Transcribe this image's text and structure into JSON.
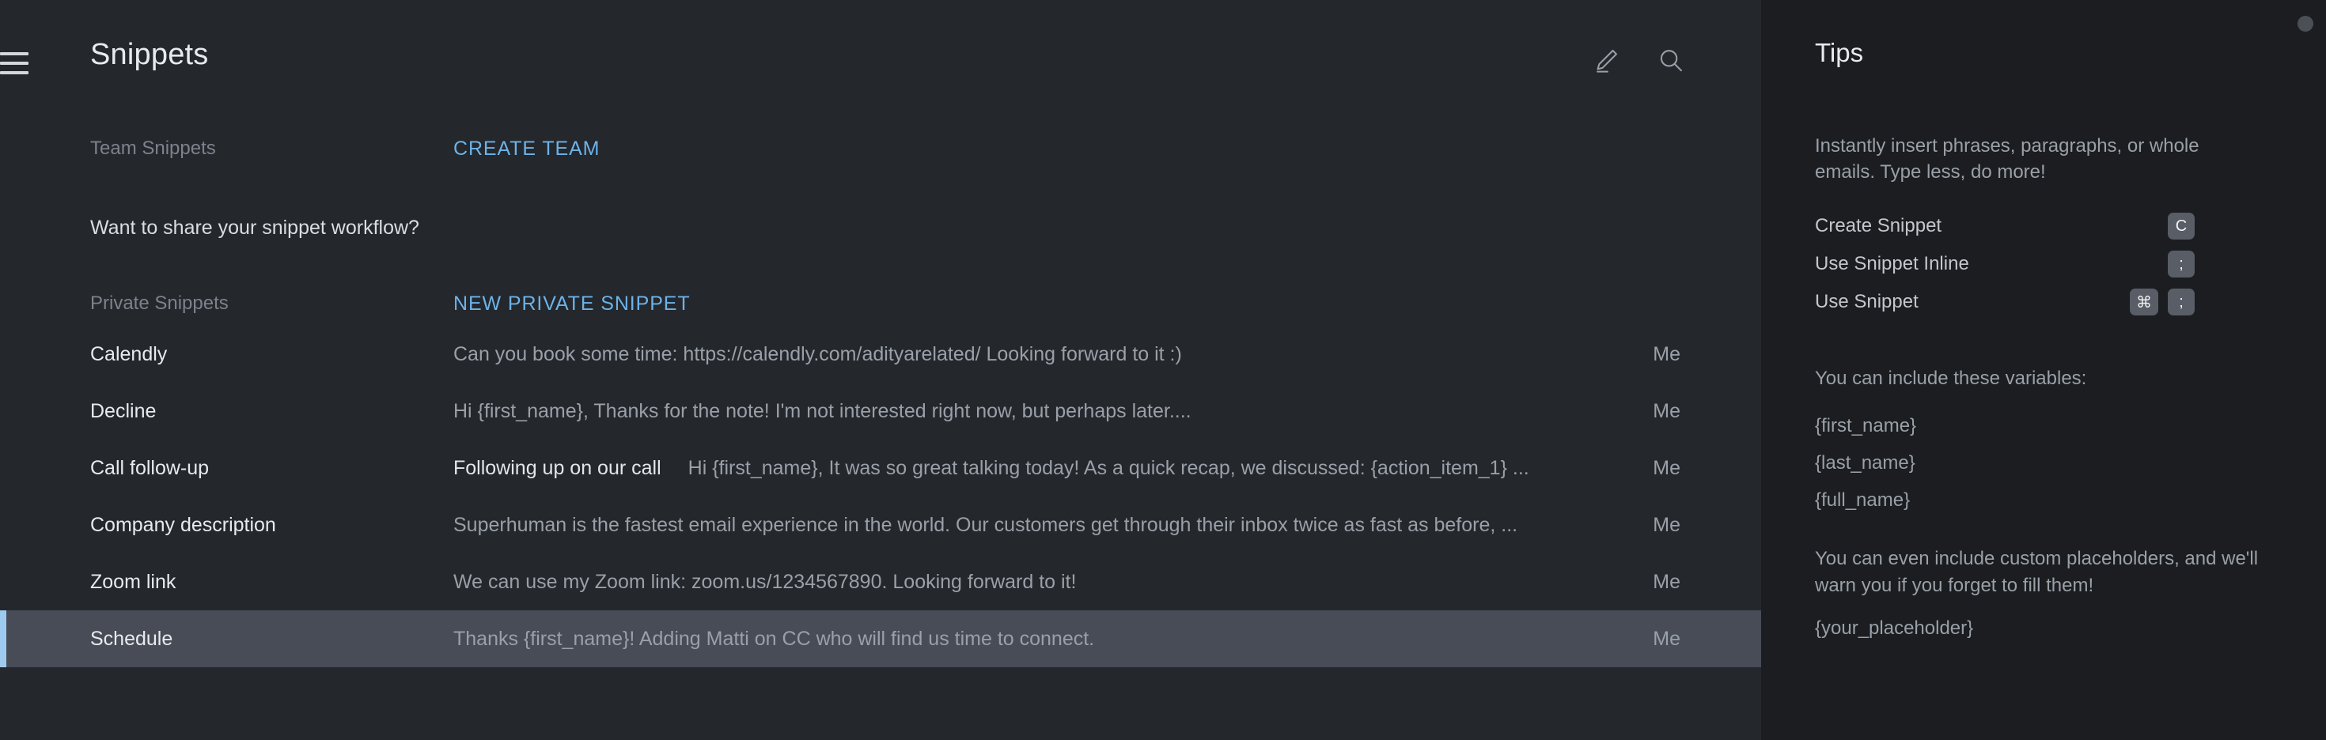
{
  "header": {
    "title": "Snippets",
    "menu_icon": "hamburger-menu-icon",
    "compose_icon": "pencil-edit-icon",
    "search_icon": "search-icon"
  },
  "sections": {
    "team": {
      "label": "Team Snippets",
      "action_label": "CREATE TEAM",
      "note": "Want to share your snippet workflow?"
    },
    "private": {
      "label": "Private Snippets",
      "action_label": "NEW PRIVATE SNIPPET"
    }
  },
  "snippets": [
    {
      "name": "Calendly",
      "subject": "",
      "preview": "Can you book some time: https://calendly.com/adityarelated/ Looking forward to it :)",
      "owner": "Me",
      "selected": false
    },
    {
      "name": "Decline",
      "subject": "",
      "preview": "Hi {first_name}, Thanks for the note! I'm not interested right now, but perhaps later....",
      "owner": "Me",
      "selected": false
    },
    {
      "name": "Call follow-up",
      "subject": "Following up on our call",
      "preview": "Hi {first_name}, It was so great talking today! As a quick recap, we discussed: {action_item_1} ...",
      "owner": "Me",
      "selected": false
    },
    {
      "name": "Company description",
      "subject": "",
      "preview": "Superhuman is the fastest email experience in the world. Our customers get through their inbox twice as fast as before, ...",
      "owner": "Me",
      "selected": false
    },
    {
      "name": "Zoom link",
      "subject": "",
      "preview": "We can use my Zoom link: zoom.us/1234567890. Looking forward to it!",
      "owner": "Me",
      "selected": false
    },
    {
      "name": "Schedule",
      "subject": "",
      "preview": "Thanks {first_name}! Adding Matti on CC who will find us time to connect.",
      "owner": "Me",
      "selected": true
    }
  ],
  "tips": {
    "title": "Tips",
    "intro": "Instantly insert phrases, paragraphs, or whole emails. Type less, do more!",
    "shortcuts": [
      {
        "label": "Create Snippet",
        "keys": [
          "C"
        ]
      },
      {
        "label": "Use Snippet Inline",
        "keys": [
          ";"
        ]
      },
      {
        "label": "Use Snippet",
        "keys": [
          "⌘",
          ";"
        ]
      }
    ],
    "variables_heading": "You can include these variables:",
    "variables": [
      "{first_name}",
      "{last_name}",
      "{full_name}"
    ],
    "outro": "You can even include custom placeholders, and we'll warn you if you forget to fill them!",
    "placeholder_example": "{your_placeholder}"
  },
  "colors": {
    "main_bg": "#24272c",
    "tips_bg": "#1b1d20",
    "accent_link": "#6cb3e8",
    "selected_row_bg": "#474c57",
    "selected_row_bar": "#9fcaf0",
    "key_bg": "#585d66"
  }
}
